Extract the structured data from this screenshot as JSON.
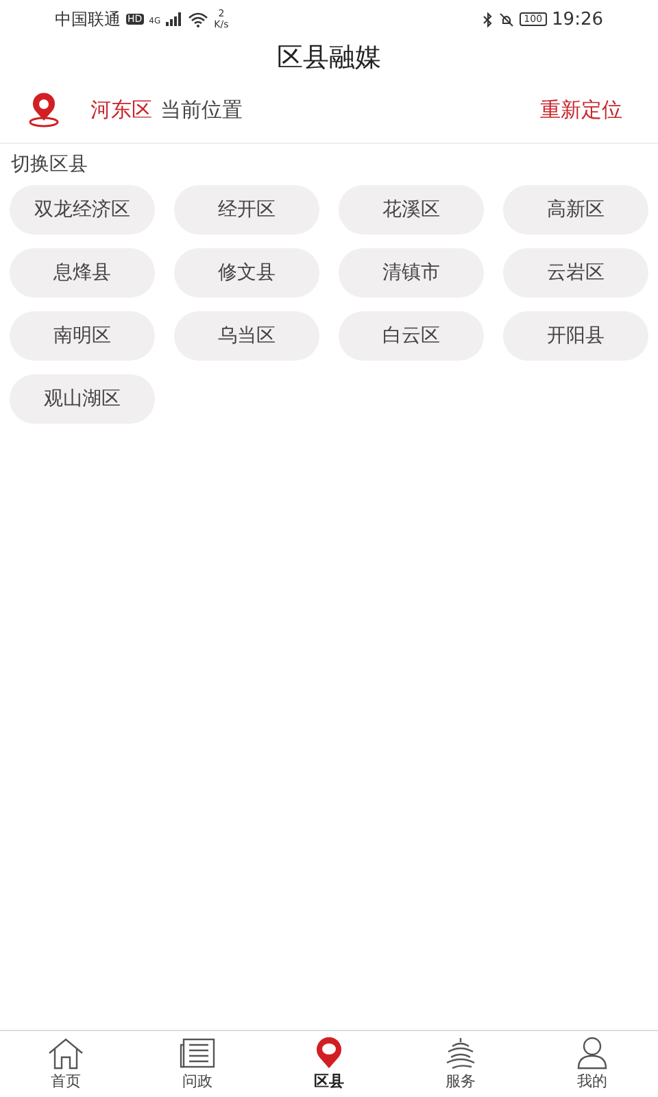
{
  "status_bar": {
    "carrier": "中国联通",
    "hd": "HD",
    "network": "4G",
    "speed_value": "2",
    "speed_unit": "K/s",
    "battery": "100",
    "time": "19:26"
  },
  "title": "区县融媒",
  "location": {
    "district": "河东区",
    "label": "当前位置",
    "action": "重新定位"
  },
  "section_label": "切换区县",
  "districts": [
    "双龙经济区",
    "经开区",
    "花溪区",
    "高新区",
    "息烽县",
    "修文县",
    "清镇市",
    "云岩区",
    "南明区",
    "乌当区",
    "白云区",
    "开阳县",
    "观山湖区"
  ],
  "tabs": [
    {
      "label": "首页",
      "kind": "home",
      "selected": false
    },
    {
      "label": "问政",
      "kind": "news",
      "selected": false
    },
    {
      "label": "区县",
      "kind": "pin",
      "selected": true
    },
    {
      "label": "服务",
      "kind": "service",
      "selected": false
    },
    {
      "label": "我的",
      "kind": "user",
      "selected": false
    }
  ]
}
